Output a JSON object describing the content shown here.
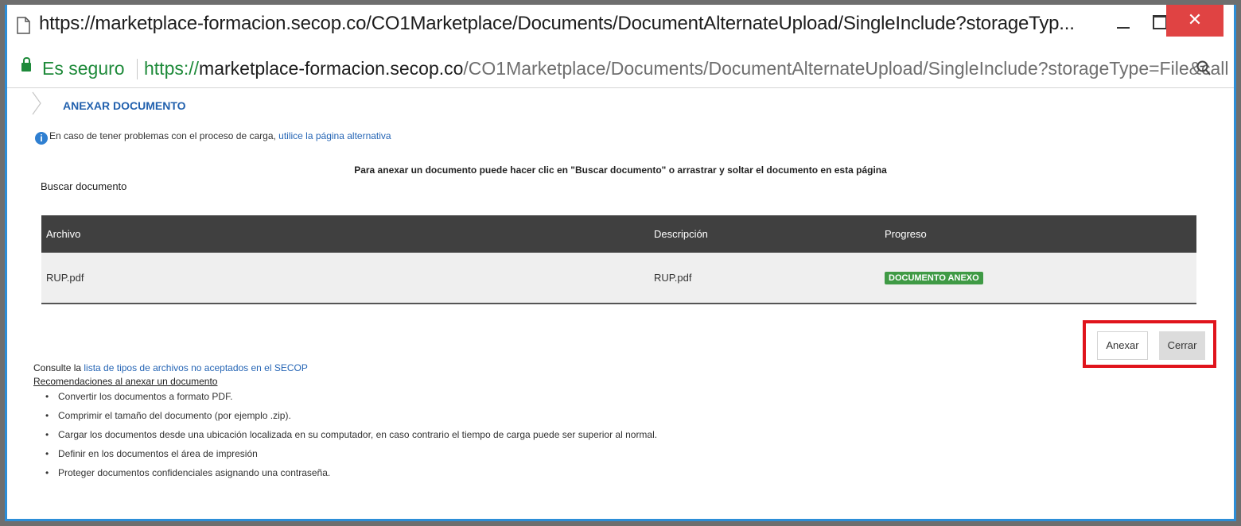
{
  "window": {
    "title": "https://marketplace-formacion.secop.co/CO1Marketplace/Documents/DocumentAlternateUpload/SingleInclude?storageTyp...",
    "close_glyph": "✕"
  },
  "address_bar": {
    "security_label": "Es seguro",
    "url_scheme": "https://",
    "url_host": "marketplace-formacion.secop.co",
    "url_path": "/CO1Marketplace/Documents/DocumentAlternateUpload/SingleInclude?storageType=File&call"
  },
  "page": {
    "heading": "ANEXAR DOCUMENTO",
    "info_icon": "i",
    "info_text": "En caso de tener problemas con el proceso de carga, ",
    "info_link": "utilice la página alternativa",
    "instruction": "Para anexar un documento puede hacer clic en \"Buscar documento\" o arrastrar y soltar el documento en esta página",
    "buscar_label": "Buscar documento"
  },
  "table": {
    "headers": [
      "Archivo",
      "Descripción",
      "Progreso"
    ],
    "rows": [
      {
        "archivo": "RUP.pdf",
        "descripcion": "RUP.pdf",
        "progreso": "DOCUMENTO ANEXO"
      }
    ]
  },
  "actions": {
    "anexar_label": "Anexar",
    "cerrar_label": "Cerrar"
  },
  "footer": {
    "consult_text": "Consulte la ",
    "consult_link": "lista de tipos de archivos no aceptados en el SECOP",
    "recommendations_title": "Recomendaciones al anexar un documento",
    "recommendations": [
      "Convertir los documentos a formato PDF.",
      "Comprimir el tamaño del documento (por ejemplo .zip).",
      "Cargar los documentos desde una ubicación localizada en su computador, en caso contrario el tiempo de carga puede ser superior al normal.",
      "Definir en los documentos el área de impresión",
      "Proteger documentos confidenciales asignando una contraseña."
    ]
  },
  "colors": {
    "accent_blue": "#2c8ed8",
    "close_red": "#e04343",
    "secure_green": "#1e8a3a",
    "table_header": "#404040",
    "badge_green": "#3f9a45",
    "highlight_red": "#e0141c"
  },
  "icons": {
    "page_icon": "document-icon",
    "lock": "lock-icon",
    "zoom": "zoom-icon",
    "chevron": "chevron-right-icon",
    "info": "info-icon"
  }
}
